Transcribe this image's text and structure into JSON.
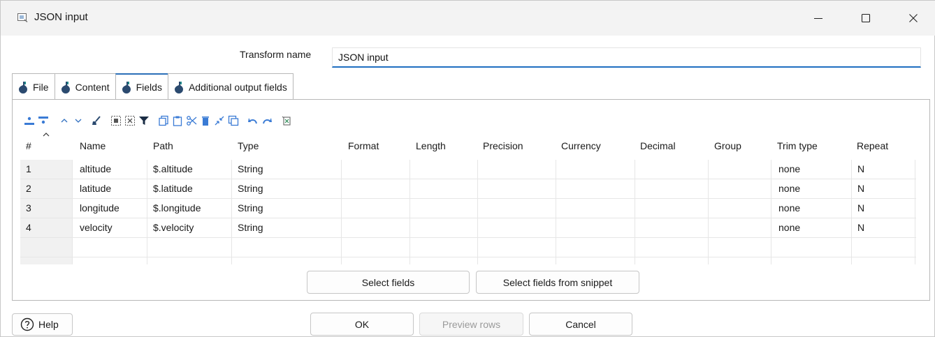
{
  "window": {
    "title": "JSON input",
    "icon": "json-input-icon"
  },
  "form": {
    "transform_name_label": "Transform name",
    "transform_name_value": "JSON input"
  },
  "tabs": [
    {
      "label": "File",
      "icon": "drop-icon"
    },
    {
      "label": "Content",
      "icon": "drop-icon"
    },
    {
      "label": "Fields",
      "icon": "drop-icon",
      "active": true
    },
    {
      "label": "Additional output fields",
      "icon": "drop-icon"
    }
  ],
  "grid": {
    "headers": [
      "#",
      "Name",
      "Path",
      "Type",
      "Format",
      "Length",
      "Precision",
      "Currency",
      "Decimal",
      "Group",
      "Trim type",
      "Repeat"
    ],
    "rows": [
      [
        "1",
        "altitude",
        "$.altitude",
        "String",
        "",
        "",
        "",
        "",
        "",
        "",
        "none",
        "N"
      ],
      [
        "2",
        "latitude",
        "$.latitude",
        "String",
        "",
        "",
        "",
        "",
        "",
        "",
        "none",
        "N"
      ],
      [
        "3",
        "longitude",
        "$.longitude",
        "String",
        "",
        "",
        "",
        "",
        "",
        "",
        "none",
        "N"
      ],
      [
        "4",
        "velocity",
        "$.velocity",
        "String",
        "",
        "",
        "",
        "",
        "",
        "",
        "none",
        "N"
      ]
    ]
  },
  "buttons": {
    "select_fields": "Select fields",
    "select_fields_snippet": "Select fields from snippet",
    "help": "Help",
    "ok": "OK",
    "preview_rows": "Preview rows",
    "cancel": "Cancel"
  },
  "colors": {
    "accent": "#1f6fc1",
    "tab_icon": "#2b4a6f",
    "tab_icon_tip": "#1d8a8a"
  }
}
